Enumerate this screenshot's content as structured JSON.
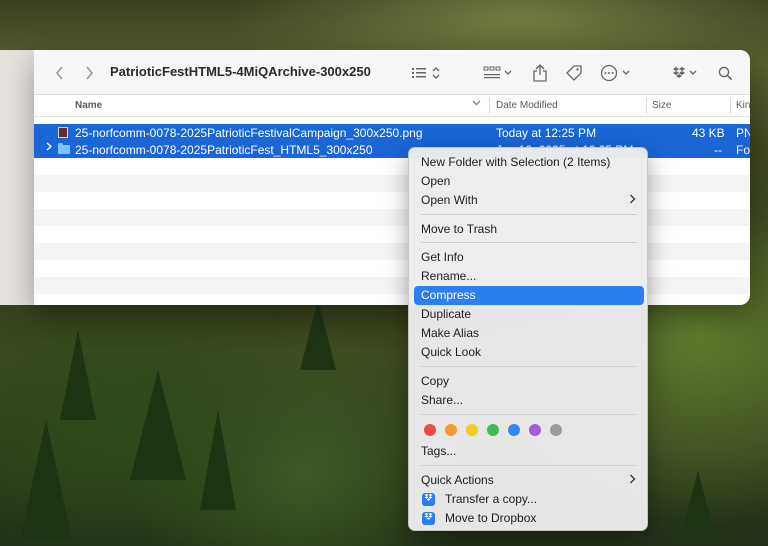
{
  "window": {
    "title": "PatrioticFestHTML5-4MiQArchive-300x250"
  },
  "toolbar": {
    "back_icon": "chevron-left-icon",
    "forward_icon": "chevron-right-icon",
    "list_view_icon": "list-view-icon",
    "group_icon": "group-grid-icon",
    "share_icon": "share-icon",
    "tag_icon": "tag-icon",
    "more_icon": "ellipsis-circle-icon",
    "dropbox_icon": "dropbox-icon",
    "search_icon": "search-icon"
  },
  "columns": {
    "name": "Name",
    "date_modified": "Date Modified",
    "size": "Size",
    "kind": "Kin"
  },
  "files": [
    {
      "name": "25-norfcomm-0078-2025PatrioticFestivalCampaign_300x250.png",
      "date": "Today at 12:25 PM",
      "size": "43 KB",
      "kind": "PN",
      "type": "png"
    },
    {
      "name": "25-norfcomm-0078-2025PatrioticFest_HTML5_300x250",
      "date": "Jun 10, 2025 at 12:25 PM",
      "size": "--",
      "kind": "Fo",
      "type": "folder"
    }
  ],
  "context_menu": {
    "items": {
      "new_folder": "New Folder with Selection (2 Items)",
      "open": "Open",
      "open_with": "Open With",
      "move_to_trash": "Move to Trash",
      "get_info": "Get Info",
      "rename": "Rename...",
      "compress": "Compress",
      "duplicate": "Duplicate",
      "make_alias": "Make Alias",
      "quick_look": "Quick Look",
      "copy": "Copy",
      "share": "Share...",
      "tags": "Tags...",
      "quick_actions": "Quick Actions",
      "transfer_copy": "Transfer a copy...",
      "move_to_dropbox": "Move to Dropbox"
    },
    "highlighted": "Compress",
    "tag_colors": [
      "#ec4b46",
      "#f29b33",
      "#f5c822",
      "#3fbd52",
      "#2f86f5",
      "#a35bd8",
      "#9a9a9f"
    ]
  }
}
